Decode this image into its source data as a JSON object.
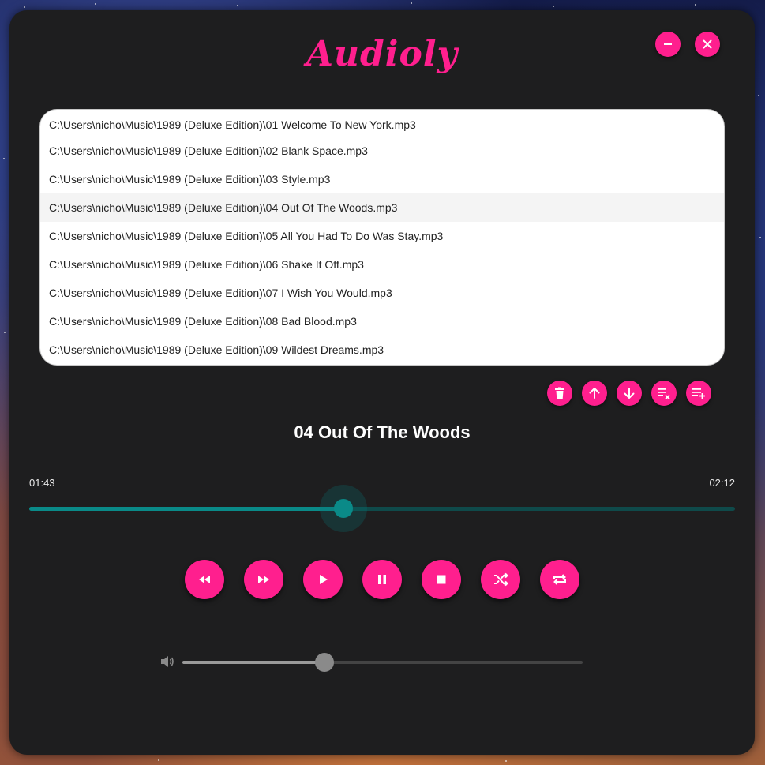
{
  "app": {
    "title": "Audioly",
    "accent_color": "#ff1f8e",
    "seek_color": "#0a8a88"
  },
  "window_controls": {
    "minimize_icon": "minus-icon",
    "close_icon": "x-icon"
  },
  "playlist": {
    "items": [
      {
        "path": "C:\\Users\\nicho\\Music\\1989 (Deluxe Edition)\\01 Welcome To New York.mp3"
      },
      {
        "path": "C:\\Users\\nicho\\Music\\1989 (Deluxe Edition)\\02 Blank Space.mp3"
      },
      {
        "path": "C:\\Users\\nicho\\Music\\1989 (Deluxe Edition)\\03 Style.mp3"
      },
      {
        "path": "C:\\Users\\nicho\\Music\\1989 (Deluxe Edition)\\04 Out Of The Woods.mp3"
      },
      {
        "path": "C:\\Users\\nicho\\Music\\1989 (Deluxe Edition)\\05 All You Had To Do Was Stay.mp3"
      },
      {
        "path": "C:\\Users\\nicho\\Music\\1989 (Deluxe Edition)\\06 Shake It Off.mp3"
      },
      {
        "path": "C:\\Users\\nicho\\Music\\1989 (Deluxe Edition)\\07 I Wish You Would.mp3"
      },
      {
        "path": "C:\\Users\\nicho\\Music\\1989 (Deluxe Edition)\\08 Bad Blood.mp3"
      },
      {
        "path": "C:\\Users\\nicho\\Music\\1989 (Deluxe Edition)\\09 Wildest Dreams.mp3"
      }
    ],
    "selected_index": 3
  },
  "playlist_tools": [
    "trash-icon",
    "arrow-up-icon",
    "arrow-down-icon",
    "playlist-remove-icon",
    "playlist-add-icon"
  ],
  "now_playing": {
    "title": "04 Out Of The Woods",
    "elapsed": "01:43",
    "duration": "02:12",
    "progress": 0.445
  },
  "transport": [
    "rewind-icon",
    "fast-forward-icon",
    "play-icon",
    "pause-icon",
    "stop-icon",
    "shuffle-icon",
    "repeat-icon"
  ],
  "volume": {
    "icon": "speaker-icon",
    "level": 0.355
  }
}
